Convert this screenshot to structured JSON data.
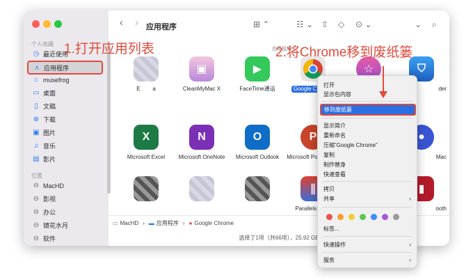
{
  "sidebar": {
    "favorites_header": "个人收藏",
    "items": [
      {
        "label": "最近使用",
        "icon": "clock-icon"
      },
      {
        "label": "应用程序",
        "icon": "apps-icon"
      },
      {
        "label": "musefrog",
        "icon": "home-icon"
      },
      {
        "label": "桌面",
        "icon": "desktop-icon"
      },
      {
        "label": "文稿",
        "icon": "document-icon"
      },
      {
        "label": "下载",
        "icon": "download-icon"
      },
      {
        "label": "图片",
        "icon": "photo-icon"
      },
      {
        "label": "音乐",
        "icon": "music-icon"
      },
      {
        "label": "影片",
        "icon": "film-icon"
      }
    ],
    "locations_header": "位置",
    "locations": [
      {
        "label": "MacHD",
        "icon": "disk-icon"
      },
      {
        "label": "影视",
        "icon": "disk-icon"
      },
      {
        "label": "办公",
        "icon": "disk-icon"
      },
      {
        "label": "镜花水月",
        "icon": "disk-icon"
      },
      {
        "label": "软件",
        "icon": "disk-icon"
      }
    ]
  },
  "toolbar": {
    "back": "‹",
    "forward": "›",
    "title": "应用程序"
  },
  "content": {
    "section_label": "应用程序",
    "apps": [
      {
        "label": "E",
        "suffix": "a"
      },
      {
        "label": "CleanMyMac X"
      },
      {
        "label": "FaceTime通话"
      },
      {
        "label": "Google Chrome"
      },
      {
        "label": ""
      },
      {
        "label": "der"
      },
      {
        "label": "Microsoft Excel"
      },
      {
        "label": "Microsoft OneNote"
      },
      {
        "label": "Microsoft Outlook"
      },
      {
        "label": "Microsoft PowerPoint"
      },
      {
        "label": "Mac"
      },
      {
        "label": "Parallels Desk"
      },
      {
        "label": "ooth"
      }
    ]
  },
  "pathbar": {
    "items": [
      "MacHD",
      "应用程序",
      "Google Chrome"
    ]
  },
  "statusbar": {
    "text": "选择了1项（共66项），25.92 GB"
  },
  "context_menu": {
    "items": [
      "打开",
      "显示包内容",
      "移到废纸篓",
      "显示简介",
      "重新命名",
      "压缩“Google Chrome”",
      "复制",
      "制作替身",
      "快速查看",
      "拷贝",
      "共享",
      "标签...",
      "快速操作",
      "服务"
    ],
    "tag_colors": [
      "#e9524a",
      "#f39c2f",
      "#f3cd34",
      "#5ac84e",
      "#3e8ef7",
      "#a45ad5",
      "#9a9a9a"
    ]
  },
  "annotations": {
    "step1": "1.打开应用列表",
    "step2": "2.将Chrome移到废纸篓"
  },
  "colors": {
    "accent": "#2b6fe0",
    "annotation": "#e04a3b"
  }
}
